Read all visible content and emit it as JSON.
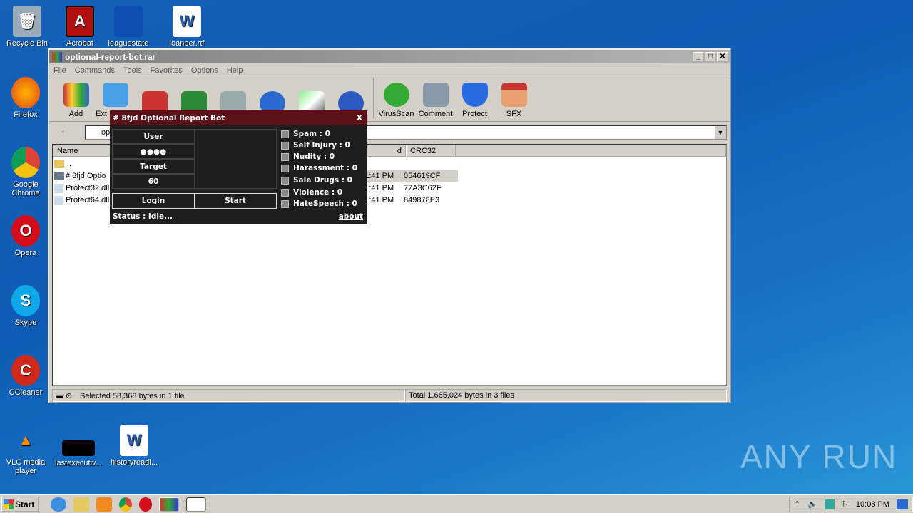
{
  "desktop": {
    "icons": [
      {
        "label": "Recycle Bin",
        "icon": "recycle-bin-icon"
      },
      {
        "label": "Acrobat",
        "icon": "acrobat-icon"
      },
      {
        "label": "leaguestate",
        "icon": "file-icon"
      },
      {
        "label": "loanber.rtf",
        "icon": "word-document-icon"
      },
      {
        "label": "Firefox",
        "icon": "firefox-icon"
      },
      {
        "label": "Google Chrome",
        "icon": "chrome-icon"
      },
      {
        "label": "Opera",
        "icon": "opera-icon"
      },
      {
        "label": "Skype",
        "icon": "skype-icon"
      },
      {
        "label": "CCleaner",
        "icon": "ccleaner-icon"
      },
      {
        "label": "VLC media player",
        "icon": "vlc-icon"
      },
      {
        "label": "lastexecutiv...",
        "icon": "black-file-icon"
      },
      {
        "label": "historyreadi...",
        "icon": "word-document-icon"
      }
    ],
    "watermark": "ANY RUN"
  },
  "winrar": {
    "title": "optional-report-bot.rar",
    "menu": [
      "File",
      "Commands",
      "Tools",
      "Favorites",
      "Options",
      "Help"
    ],
    "toolbar": [
      "Add",
      "Ext",
      "",
      "",
      "",
      "",
      "",
      "",
      "VirusScan",
      "Comment",
      "Protect",
      "SFX"
    ],
    "address": "op",
    "columns": {
      "name": "Name",
      "modified": "d",
      "crc": "CRC32"
    },
    "rows": [
      {
        "name": "..",
        "modified": "",
        "crc": ""
      },
      {
        "name": "# 8fjd Optio",
        "modified": "0 1:41 PM",
        "crc": "054619CF"
      },
      {
        "name": "Protect32.dll",
        "modified": "0 1:41 PM",
        "crc": "77A3C62F"
      },
      {
        "name": "Protect64.dll",
        "modified": "0 1:41 PM",
        "crc": "849878E3"
      }
    ],
    "status_left": "Selected 58,368 bytes in 1 file",
    "status_right": "Total 1,665,024 bytes in 3 files"
  },
  "dialog": {
    "title": "# 8fjd Optional Report Bot",
    "close": "X",
    "user_label": "User",
    "user_value": "●●●●",
    "target_label": "Target",
    "target_value": "60",
    "login": "Login",
    "start": "Start",
    "checks": [
      "Spam : 0",
      "Self Injury :  0",
      "Nudity :  0",
      "Harassment : 0",
      "Sale Drugs : 0",
      "Violence : 0",
      "HateSpeech : 0"
    ],
    "status": "Status : Idle...",
    "about": "about"
  },
  "taskbar": {
    "start": "Start",
    "clock": "10:08 PM"
  }
}
